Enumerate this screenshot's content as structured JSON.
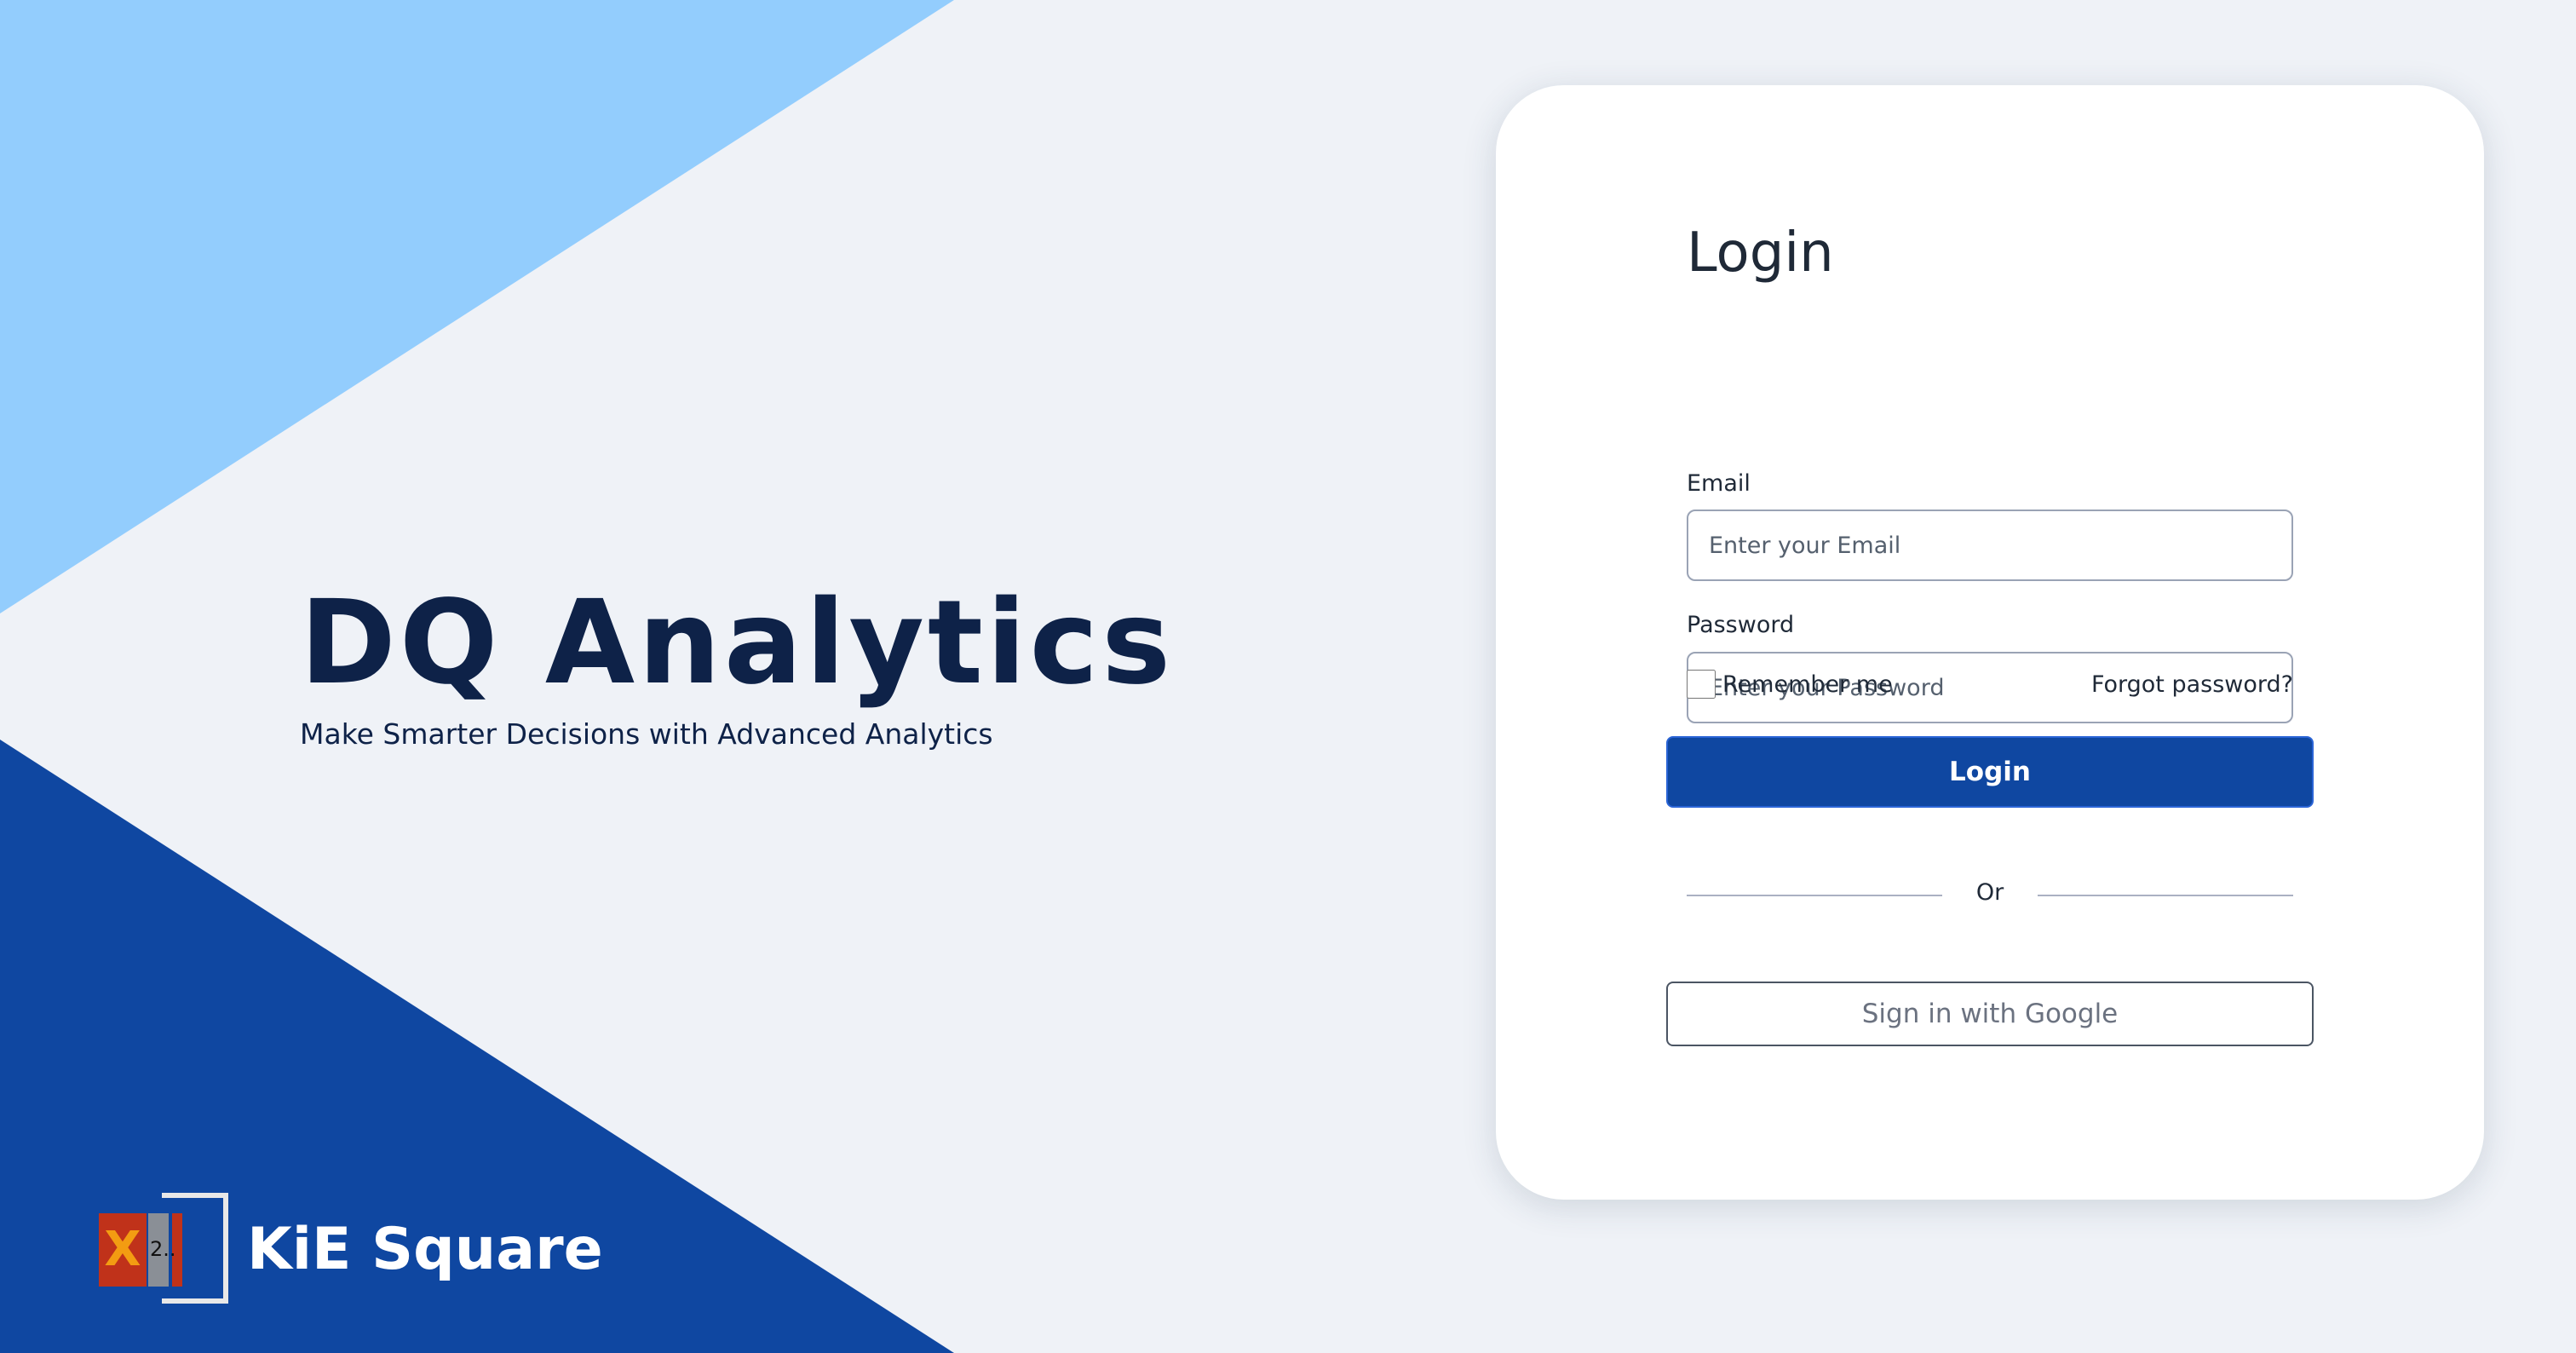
{
  "brand": {
    "title": "DQ Analytics",
    "tagline": "Make Smarter Decisions with Advanced Analytics"
  },
  "logo": {
    "name": "KiE Square",
    "mark_letter": "X",
    "mark_number": "2.."
  },
  "login": {
    "heading": "Login",
    "email_label": "Email",
    "email_placeholder": "Enter your Email",
    "email_value": "",
    "password_label": "Password",
    "password_placeholder": "Enter your Password",
    "password_value": "",
    "remember_label": "Remember me",
    "remember_checked": false,
    "forgot_label": "Forgot password?",
    "submit_label": "Login",
    "divider_text": "Or",
    "google_label": "Sign in with Google"
  },
  "colors": {
    "background": "#eff2f7",
    "light_blue": "#93cdfd",
    "dark_blue": "#0f47a1",
    "brand_text": "#0e2248",
    "card": "#ffffff"
  }
}
